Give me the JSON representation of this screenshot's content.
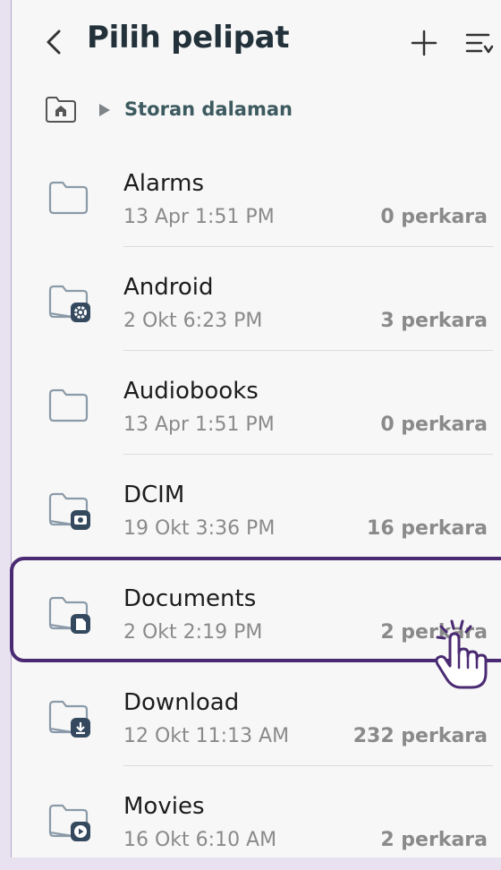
{
  "header": {
    "title": "Pilih pelipat"
  },
  "breadcrumb": {
    "label": "Storan dalaman"
  },
  "folders": [
    {
      "name": "Alarms",
      "date": "13 Apr 1:51 PM",
      "count": "0 perkara",
      "icon": "folder-icon"
    },
    {
      "name": "Android",
      "date": "2 Okt 6:23 PM",
      "count": "3 perkara",
      "icon": "folder-settings-icon"
    },
    {
      "name": "Audiobooks",
      "date": "13 Apr 1:51 PM",
      "count": "0 perkara",
      "icon": "folder-icon"
    },
    {
      "name": "DCIM",
      "date": "19 Okt 3:36 PM",
      "count": "16 perkara",
      "icon": "folder-camera-icon"
    },
    {
      "name": "Documents",
      "date": "2 Okt 2:19 PM",
      "count": "2 perkara",
      "icon": "folder-document-icon"
    },
    {
      "name": "Download",
      "date": "12 Okt 11:13 AM",
      "count": "232 perkara",
      "icon": "folder-download-icon"
    },
    {
      "name": "Movies",
      "date": "16 Okt 6:10 AM",
      "count": "2 perkara",
      "icon": "folder-play-icon"
    }
  ],
  "colors": {
    "accent": "#4a2a72",
    "title": "#22313a",
    "icon_badge": "#34495e"
  }
}
